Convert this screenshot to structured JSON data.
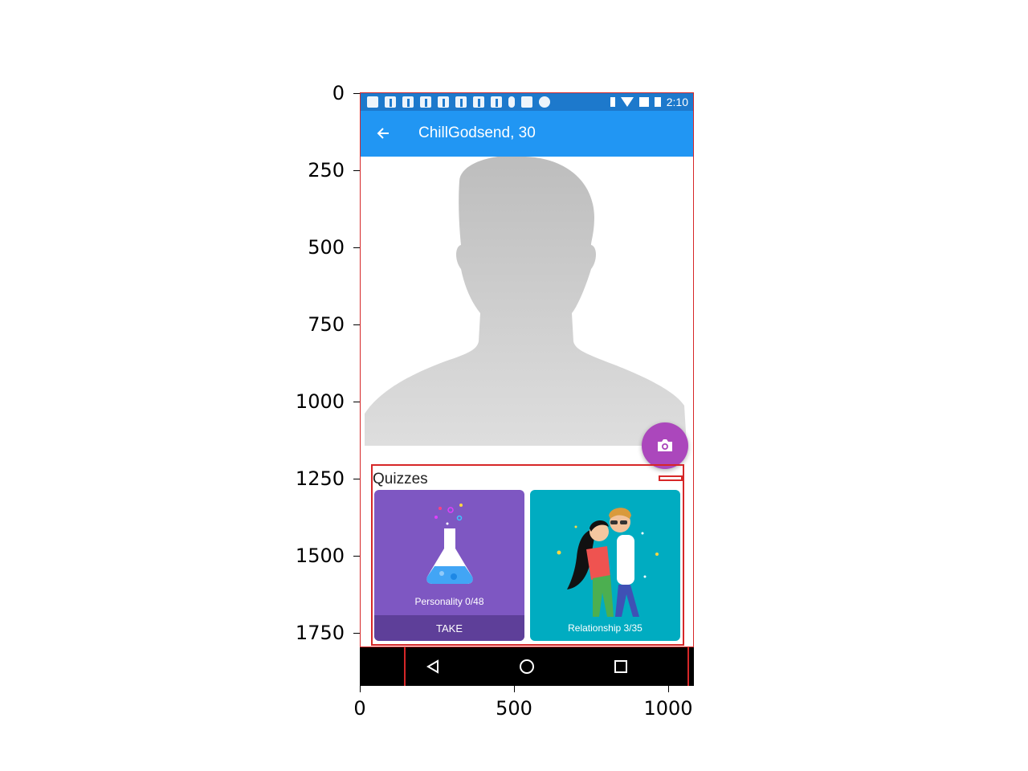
{
  "axes": {
    "y_ticks": [
      "0",
      "250",
      "500",
      "750",
      "1000",
      "1250",
      "1500",
      "1750"
    ],
    "x_ticks": [
      "0",
      "500",
      "1000"
    ]
  },
  "status_bar": {
    "time": "2:10",
    "notification_icons": [
      "message-icon",
      "facebook-icon",
      "facebook-icon",
      "facebook-icon",
      "facebook-icon",
      "facebook-icon",
      "facebook-icon",
      "facebook-icon",
      "person-icon",
      "news-icon",
      "sync-icon"
    ],
    "system_icons": [
      "bluetooth-icon",
      "wifi-icon",
      "no-sim-icon",
      "battery-icon"
    ]
  },
  "app_bar": {
    "title": "ChillGodsend, 30",
    "back_icon": "arrow-left-icon"
  },
  "profile": {
    "photo": "default-avatar-silhouette",
    "fab_icon": "camera-icon"
  },
  "quizzes": {
    "title": "Quizzes",
    "cards": [
      {
        "caption": "Personality 0/48",
        "action": "TAKE",
        "icon": "flask-icon",
        "color": "#7e57c2"
      },
      {
        "caption": "Relationship 3/35",
        "icon": "couple-illustration",
        "color": "#00acc1"
      }
    ]
  },
  "nav_bar": {
    "icons": [
      "back-triangle-icon",
      "home-circle-icon",
      "recents-square-icon"
    ]
  },
  "colors": {
    "status_bar": "#1d79cc",
    "app_bar": "#2196f3",
    "fab": "#ab47bc",
    "highlight": "#d62728"
  }
}
